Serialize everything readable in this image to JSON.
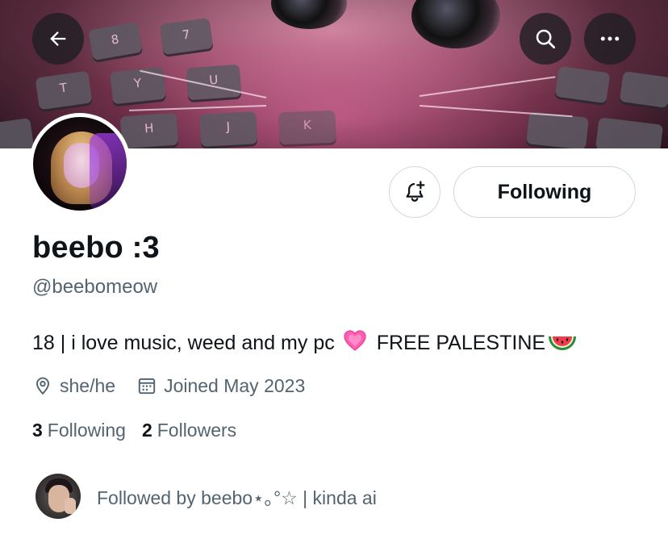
{
  "header": {
    "back_icon": "arrow-left-icon",
    "search_icon": "search-icon",
    "more_icon": "more-horizontal-icon"
  },
  "banner": {
    "keys": [
      "T",
      "Y",
      "U",
      "H",
      "J",
      "K",
      "8",
      "7"
    ]
  },
  "actions": {
    "notify_icon": "bell-plus-icon",
    "follow_label": "Following"
  },
  "profile": {
    "display_name": "beebo :3",
    "handle": "@beebomeow",
    "bio_start": "18 | i love music, weed and my pc",
    "bio_heart_emoji": "💗",
    "bio_end": "FREE PALESTINE",
    "bio_watermelon_emoji": "🍉",
    "location": "she/he",
    "joined": "Joined May 2023"
  },
  "stats": {
    "following_count": "3",
    "following_label": "Following",
    "followers_count": "2",
    "followers_label": "Followers"
  },
  "followed_by": {
    "text": "Followed by beebo⋆｡°☆ | kinda ai"
  },
  "colors": {
    "text_primary": "#0f1419",
    "text_secondary": "#536471",
    "border": "#cfd9de"
  }
}
